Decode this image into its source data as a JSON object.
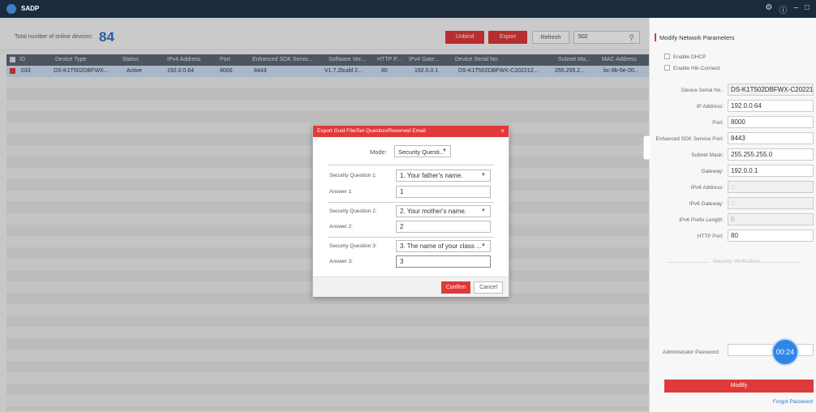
{
  "app": {
    "title": "SADP",
    "icon": "sadp-logo-icon",
    "window_controls": [
      "gear-icon",
      "info-icon",
      "minimize-icon",
      "maximize-icon"
    ]
  },
  "toolbar": {
    "total_label": "Total number of online devices:",
    "total_count": "84",
    "unbind_label": "Unbind",
    "export_label": "Export",
    "refresh_label": "Refresh",
    "search_value": "502"
  },
  "table": {
    "headers": [
      "ID",
      "Device Type",
      "Status",
      "IPv4 Address",
      "Port",
      "Enhanced SDK Servic...",
      "Software Ver...",
      "HTTP P...",
      "IPv4 Gate...",
      "Device Serial No.",
      "Subnet Ma...",
      "MAC Address"
    ],
    "row": [
      "033",
      "DS-K1T502DBFWX...",
      "Active",
      "192.0.0.64",
      "8000",
      "8443",
      "V1.7.2build 2...",
      "80",
      "192.0.0.1",
      "DS-K1T502DBFWX-C202212...",
      "255.255.2...",
      "bc-9b-5e-20..."
    ]
  },
  "dialog": {
    "title": "Export Guid File/Set Question/Reserved Email",
    "mode_label": "Mode:",
    "mode_value": "Security Questi...",
    "q1_label": "Security Question 1:",
    "q1_value": "1. Your father's name.",
    "a1_label": "Answer 1:",
    "a1_value": "1",
    "q2_label": "Security Question 2:",
    "q2_value": "2. Your mother's name.",
    "a2_label": "Answer 2:",
    "a2_value": "2",
    "q3_label": "Security Question 3:",
    "q3_value": "3. The name of your class ...",
    "a3_label": "Answer 3:",
    "a3_value": "3",
    "confirm_label": "Confirm",
    "cancel_label": "Cancel"
  },
  "panel": {
    "title": "Modify Network Parameters",
    "enable_dhcp": "Enable DHCP",
    "enable_hik": "Enable Hik-Connect",
    "fields": [
      {
        "label": "Device Serial No.:",
        "value": "DS-K1T502DBFWX-C20221"
      },
      {
        "label": "IP Address:",
        "value": "192.0.0.64"
      },
      {
        "label": "Port:",
        "value": "8000"
      },
      {
        "label": "Enhanced SDK Service Port:",
        "value": "8443"
      },
      {
        "label": "Subnet Mask:",
        "value": "255.255.255.0"
      },
      {
        "label": "Gateway:",
        "value": "192.0.0.1"
      },
      {
        "label": "IPv6 Address:",
        "value": "::"
      },
      {
        "label": "IPv6 Gateway:",
        "value": "::"
      },
      {
        "label": "IPv6 Prefix Length:",
        "value": "0"
      },
      {
        "label": "HTTP Port:",
        "value": "80"
      }
    ],
    "security_verification": "Security Verification",
    "admin_password_label": "Administrator Password:",
    "timer": "00:24",
    "modify_label": "Modify",
    "forgot_label": "Forgot Password"
  },
  "colors": {
    "accent": "#e0393a",
    "titlebar": "#1b2b3e",
    "link": "#2f72c4",
    "timer": "#2f86e8"
  }
}
